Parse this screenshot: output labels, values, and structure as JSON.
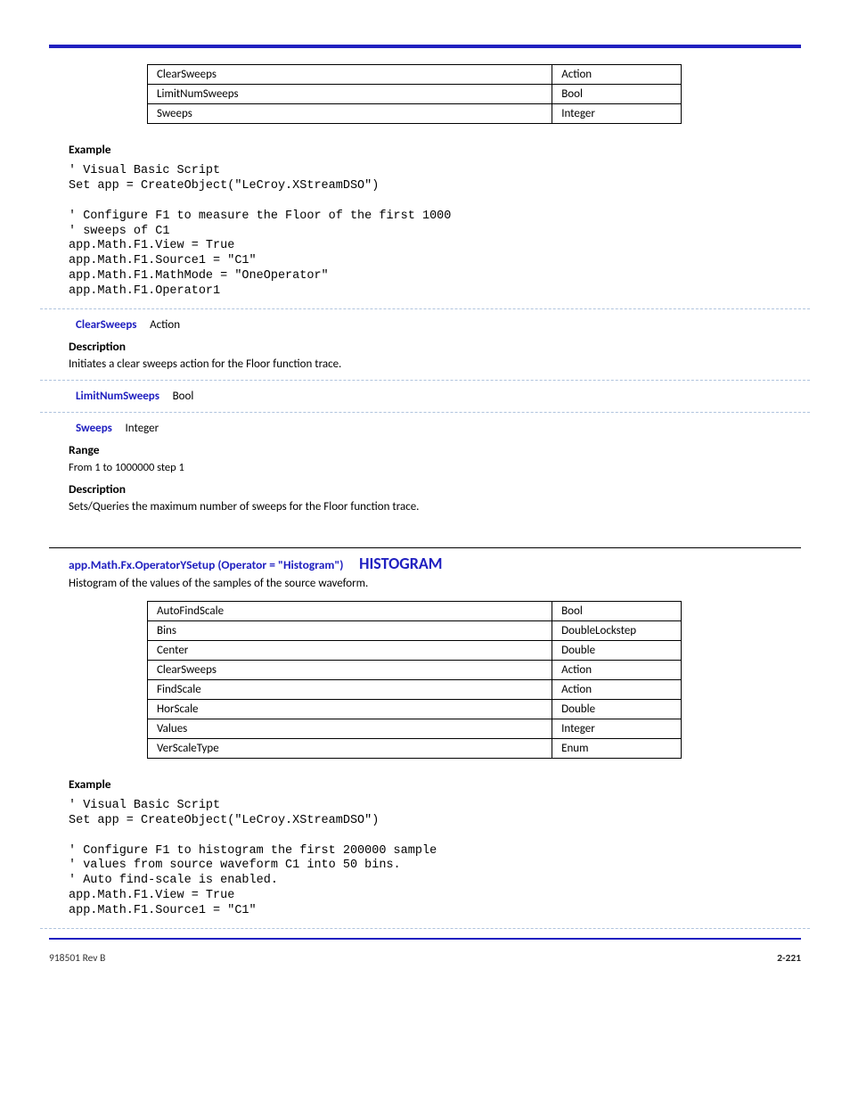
{
  "table1": {
    "rows": [
      {
        "left": "ClearSweeps",
        "right": "Action"
      },
      {
        "left": "LimitNumSweeps",
        "right": "Bool"
      },
      {
        "left": "Sweeps",
        "right": "Integer"
      }
    ]
  },
  "example1": {
    "label": "Example",
    "code": "' Visual Basic Script\nSet app = CreateObject(\"LeCroy.XStreamDSO\")\n\n' Configure F1 to measure the Floor of the first 1000\n' sweeps of C1\napp.Math.F1.View = True\napp.Math.F1.Source1 = \"C1\"\napp.Math.F1.MathMode = \"OneOperator\"\napp.Math.F1.Operator1"
  },
  "clearSweeps": {
    "name": "ClearSweeps",
    "type": "Action",
    "descLabel": "Description",
    "desc": "Initiates a clear sweeps action for the Floor function trace."
  },
  "limitNumSweeps": {
    "name": "LimitNumSweeps",
    "type": "Bool"
  },
  "sweeps": {
    "name": "Sweeps",
    "type": "Integer",
    "rangeLabel": "Range",
    "rangeText": "From 1 to 1000000 step 1",
    "descLabel": "Description",
    "desc": "Sets/Queries the maximum number of sweeps for the Floor function trace."
  },
  "histogramSection": {
    "pathPrefix": "app.Math.Fx.OperatorYSetup (Operator = \"Histogram\")",
    "title": "HISTOGRAM",
    "desc": "Histogram of the values of the samples of the source waveform."
  },
  "table2": {
    "rows": [
      {
        "left": "AutoFindScale",
        "right": "Bool"
      },
      {
        "left": "Bins",
        "right": "DoubleLockstep"
      },
      {
        "left": "Center",
        "right": "Double"
      },
      {
        "left": "ClearSweeps",
        "right": "Action"
      },
      {
        "left": "FindScale",
        "right": "Action"
      },
      {
        "left": "HorScale",
        "right": "Double"
      },
      {
        "left": "Values",
        "right": "Integer"
      },
      {
        "left": "VerScaleType",
        "right": "Enum"
      }
    ]
  },
  "example2": {
    "label": "Example",
    "code": "' Visual Basic Script\nSet app = CreateObject(\"LeCroy.XStreamDSO\")\n\n' Configure F1 to histogram the first 200000 sample\n' values from source waveform C1 into 50 bins.\n' Auto find-scale is enabled.\napp.Math.F1.View = True\napp.Math.F1.Source1 = \"C1\""
  },
  "footer": {
    "left": "918501 Rev B",
    "right": "2-221"
  }
}
